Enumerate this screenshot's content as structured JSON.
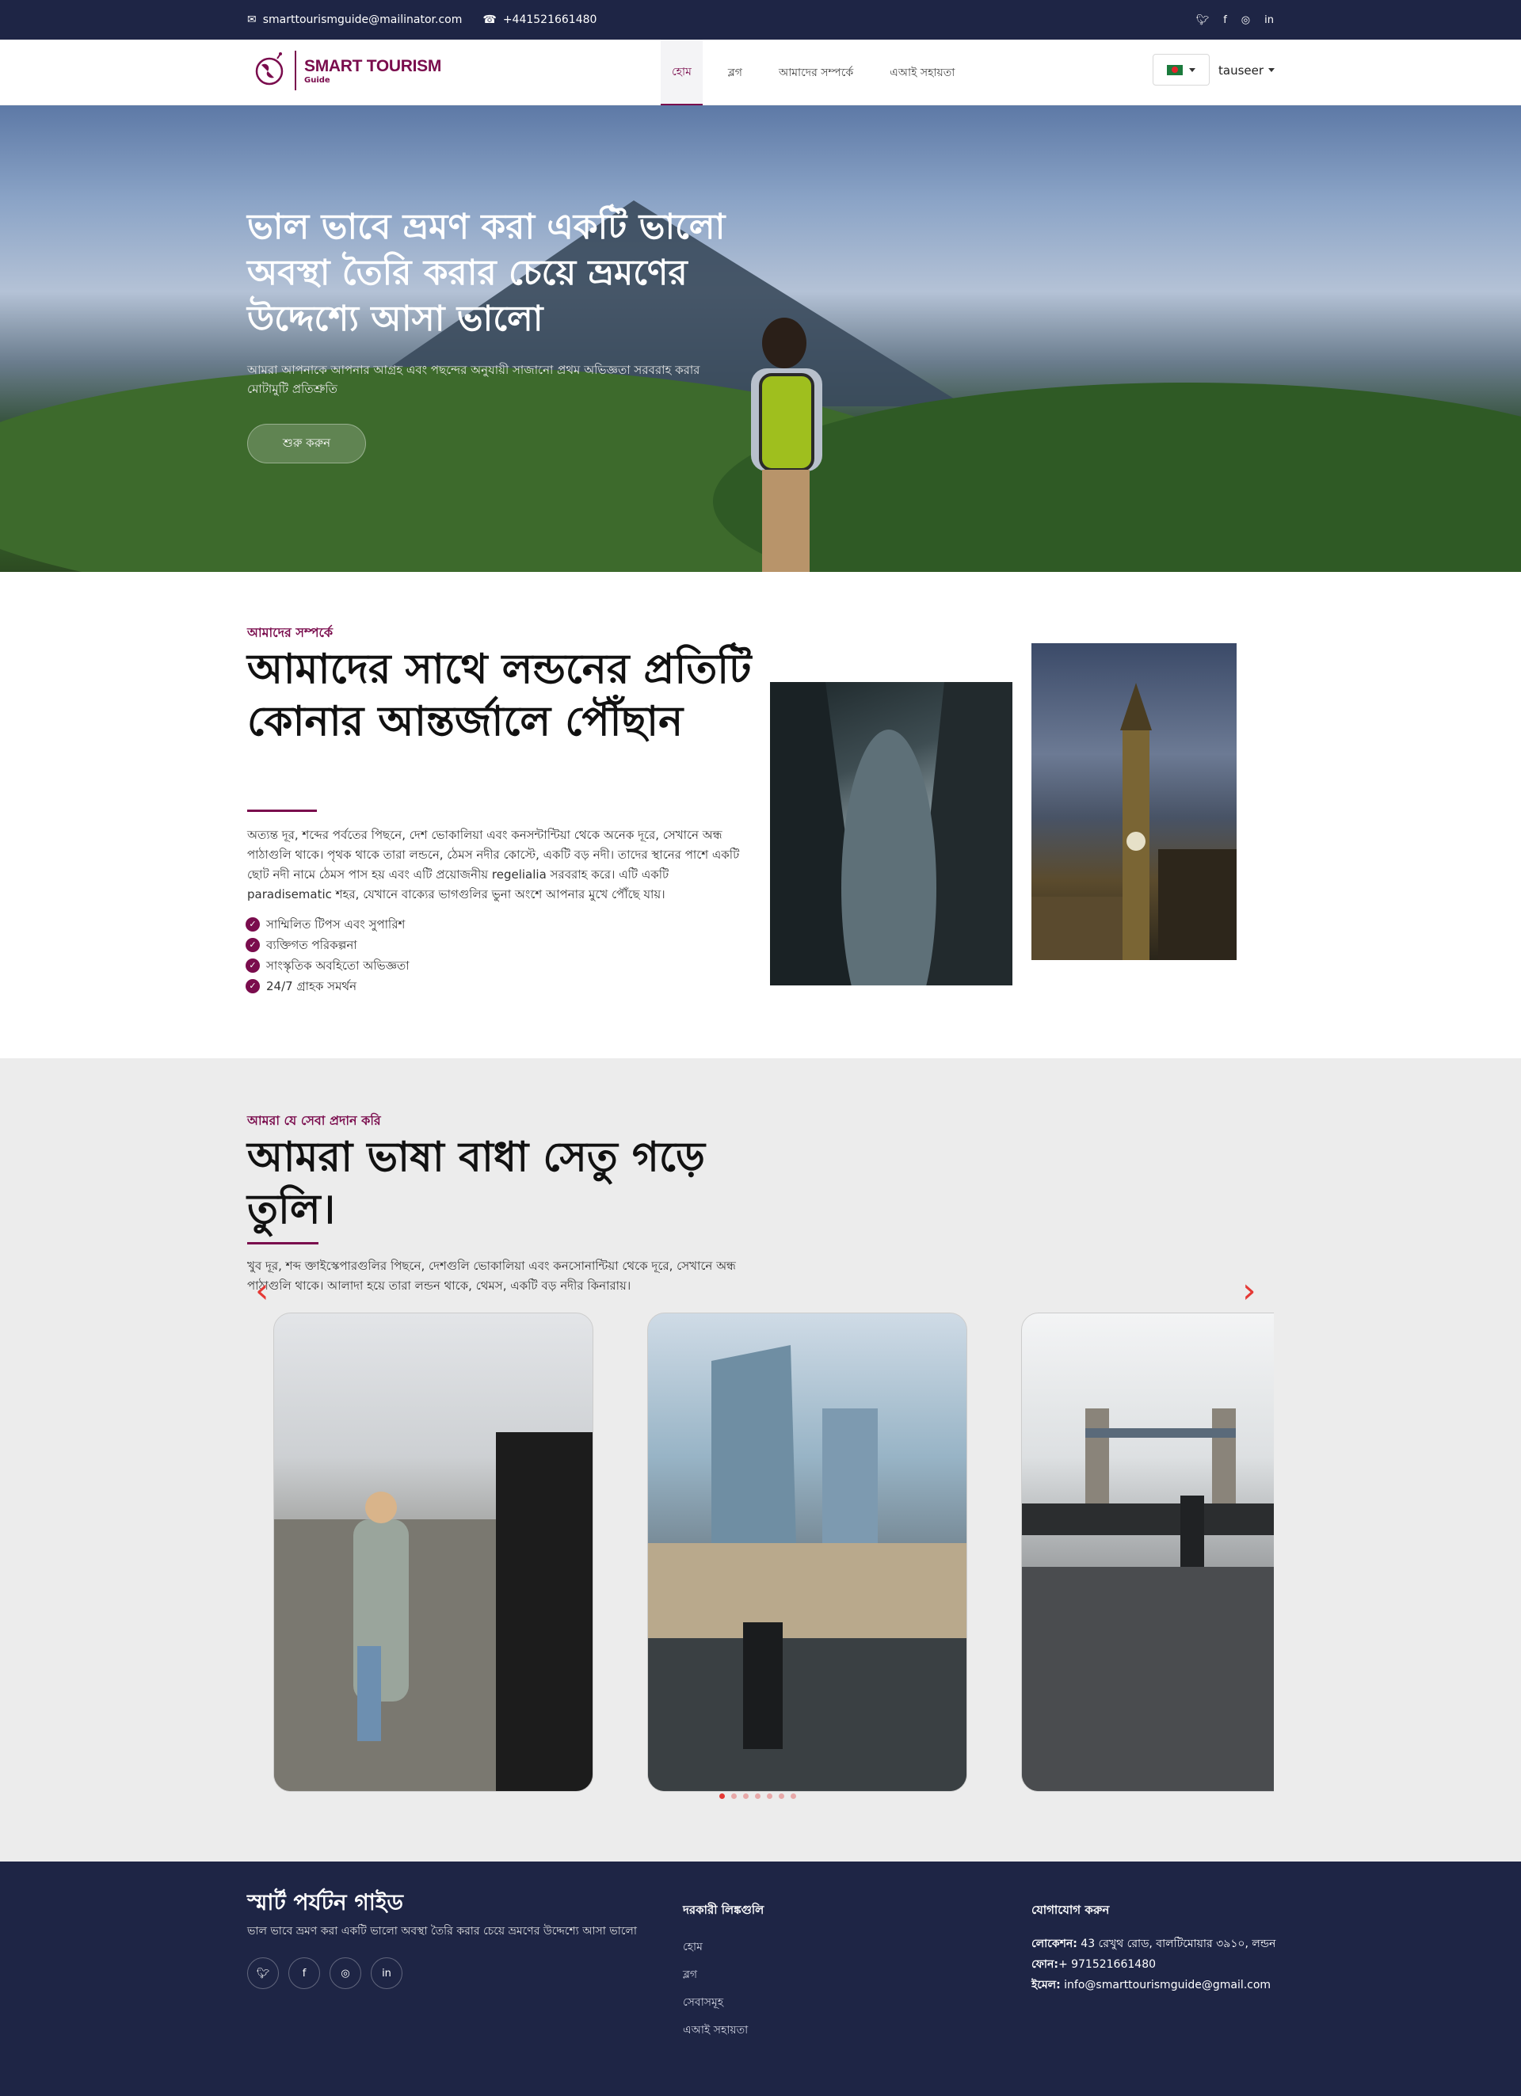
{
  "topbar": {
    "email": "smarttourismguide@mailinator.com",
    "phone": "+441521661480",
    "social_icons": [
      "twitter-icon",
      "facebook-icon",
      "instagram-icon",
      "linkedin-icon"
    ]
  },
  "nav": {
    "logo_title": "SMART TOURISM",
    "logo_subtitle": "Guide",
    "items": [
      {
        "label": "হোম",
        "active": true
      },
      {
        "label": "ব্লগ",
        "active": false
      },
      {
        "label": "আমাদের সম্পর্কে",
        "active": false
      },
      {
        "label": "এআই সহায়তা",
        "active": false
      }
    ],
    "language": "Bangladesh",
    "user": "tauseer"
  },
  "hero": {
    "title": "ভাল ভাবে ভ্রমণ করা একটি ভালো অবস্থা তৈরি করার চেয়ে ভ্রমণের উদ্দেশ্যে আসা ভালো",
    "subtitle": "আমরা আপনাকে আপনার আগ্রহ এবং পছন্দের অনুযায়ী সাজানো প্রথম অভিজ্ঞতা সরবরাহ করার মোটামুটি প্রতিশ্রুতি",
    "cta": "শুরু করুন"
  },
  "about": {
    "eyebrow": "আমাদের সম্পর্কে",
    "title": "আমাদের সাথে লন্ডনের প্রতিটি কোনার আন্তর্জালে পৌঁছান",
    "text": "অত্যন্ত দূর, শব্দের পর্বতের পিছনে, দেশ ভোকালিয়া এবং কনসন্টান্টিয়া থেকে অনেক দূরে, সেখানে অন্ধ পাঠাগুলি থাকে। পৃথক থাকে তারা লন্ডনে, ঠেমস নদীর কোস্টে, একটি বড় নদী। তাদের স্থানের পাশে একটি ছোট নদী নামে ঠেমস পাস হয় এবং এটি প্রয়োজনীয় regelialia সরবরাহ করে। এটি একটি paradisematic শহর, যেখানে বাক্যের ভাগগুলির ভুনা অংশে আপনার মুখে পৌঁছে যায়।",
    "features": [
      "সাম্মিলিত টিপস এবং সুপারিশ",
      "ব্যক্তিগত পরিকল্পনা",
      "সাংস্কৃতিক অবহিতো অভিজ্ঞতা",
      "24/7 গ্রাহক সমর্থন"
    ]
  },
  "services": {
    "eyebrow": "আমরা যে সেবা প্রদান করি",
    "title": "আমরা ভাষা বাধা সেতু গড়ে তুলি।",
    "text": "খুব দূর, শব্দ ক্তাইস্কেপারগুলির পিছনে, দেশগুলি ভোকালিয়া এবং কনসোনান্টিয়া থেকে দূরে, সেখানে অন্ধ পাঠাগুলি থাকে। আলাদা হয়ে তারা লন্ডন থাকে, থেমস, একটি বড় নদীর কিনারায়।",
    "carousel_dots": 7,
    "active_dot": 0
  },
  "footer": {
    "brand": "স্মার্ট পর্যটন গাইড",
    "tagline": "ভাল ভাবে ভ্রমণ করা একটি ভালো অবস্থা তৈরি করার চেয়ে ভ্রমণের উদ্দেশ্যে আসা ভালো",
    "links_title": "দরকারী লিঙ্কগুলি",
    "links": [
      "হোম",
      "ব্লগ",
      "সেবাসমূহ",
      "এআই সহায়তা"
    ],
    "contact_title": "যোগাযোগ করুন",
    "location_label": "লোকেশন:",
    "location": "43 রেখুথ রোড, বালটিমোয়ার ৩৯১০, লন্ডন",
    "phone_label": "ফোন:",
    "phone": "+ 971521661480",
    "email_label": "ইমেল:",
    "email": "info@smarttourismguide@gmail.com"
  },
  "colors": {
    "navy": "#1e2545",
    "accent": "#7a0c4d",
    "carousel_arrow": "#e53935"
  }
}
